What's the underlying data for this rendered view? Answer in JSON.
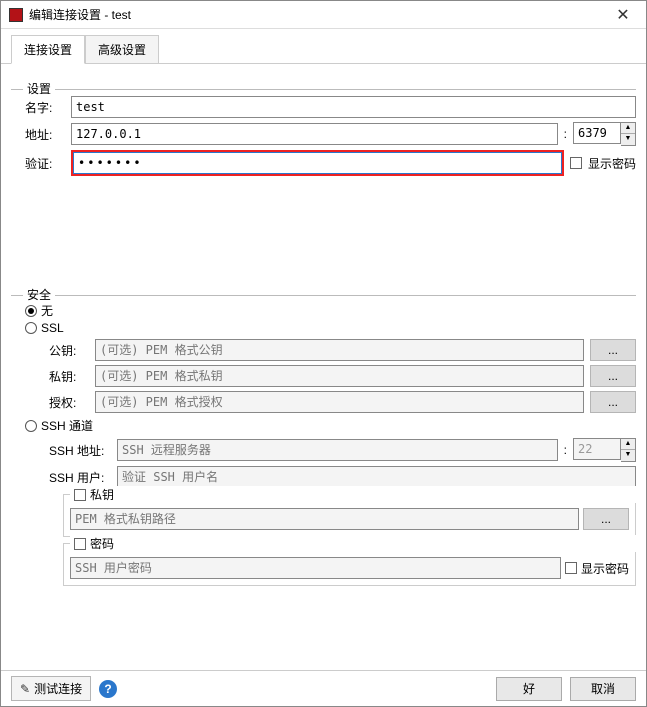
{
  "titlebar": {
    "title": "编辑连接设置 - test"
  },
  "tabs": {
    "connect": "连接设置",
    "advanced": "高级设置"
  },
  "settings": {
    "group_label": "设置",
    "name_label": "名字:",
    "name_value": "test",
    "addr_label": "地址:",
    "addr_value": "127.0.0.1",
    "port_value": "6379",
    "auth_label": "验证:",
    "auth_value": "●●●●●●●",
    "show_pw_label": "显示密码"
  },
  "security": {
    "group_label": "安全",
    "none_label": "无",
    "ssl_label": "SSL",
    "pubkey_label": "公钥:",
    "pubkey_ph": "(可选) PEM 格式公钥",
    "privkey_label": "私钥:",
    "privkey_ph": "(可选) PEM 格式私钥",
    "grant_label": "授权:",
    "grant_ph": "(可选) PEM 格式授权",
    "browse_label": "...",
    "ssh_label": "SSH 通道",
    "ssh_addr_label": "SSH 地址:",
    "ssh_addr_ph": "SSH 远程服务器",
    "ssh_port_value": "22",
    "ssh_user_label": "SSH 用户:",
    "ssh_user_ph": "验证 SSH 用户名",
    "ssh_privkey_title": "私钥",
    "ssh_privkey_ph": "PEM 格式私钥路径",
    "ssh_pw_title": "密码",
    "ssh_pw_ph": "SSH 用户密码",
    "ssh_show_pw_label": "显示密码"
  },
  "bottom": {
    "test_label": "测试连接",
    "ok_label": "好",
    "cancel_label": "取消"
  }
}
